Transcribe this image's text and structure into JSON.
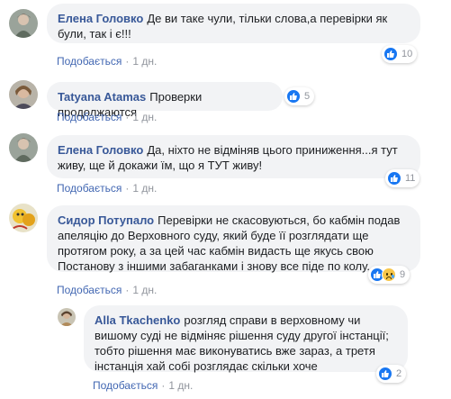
{
  "comments": [
    {
      "author": "Елена Головко",
      "text": "Де ви таке чули, тільки слова,а перевірки як були, так і є!!!",
      "like_label": "Подобається",
      "time": "1 дн.",
      "reactions_count": "10"
    },
    {
      "author": "Tatyana Atamas",
      "text": "Проверки продолжаются",
      "like_label": "Подобається",
      "time": "1 дн.",
      "reactions_count": "5"
    },
    {
      "author": "Елена Головко",
      "text": "Да, ніхто не відміняв цього приниження...я тут живу, ще й докажи їм, що я ТУТ живу!",
      "like_label": "Подобається",
      "time": "1 дн.",
      "reactions_count": "11"
    },
    {
      "author": "Сидор Потупало",
      "text": "Перевірки не скасовуються, бо кабмін подав апеляцію до Верховного суду, який буде її розглядати ще протягом року, а за цей час кабмін видасть ще якусь свою Постанову з іншими забаганками і знову все піде по колу.",
      "like_label": "Подобається",
      "time": "1 дн.",
      "reactions_count": "9"
    },
    {
      "author": "Alla Tkachenko",
      "text": "розгляд справи в верховному чи вишому суді не відміняє рішення суду другої інстанції; тобто рішення має виконуватись вже зараз, а третя інстанція хай собі розглядає скільки хоче",
      "like_label": "Подобається",
      "time": "1 дн.",
      "reactions_count": "2"
    }
  ],
  "colors": {
    "author": "#385898",
    "bubble": "#f2f3f5",
    "like_blue": "#1877f2",
    "meta": "#90949c"
  },
  "icons": [
    "like-icon",
    "sad-icon"
  ]
}
